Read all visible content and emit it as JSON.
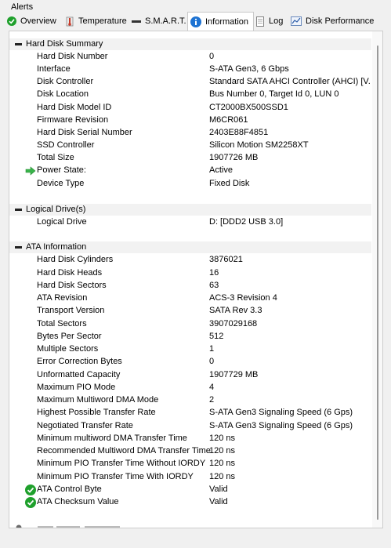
{
  "alerts": {
    "label": "Alerts"
  },
  "tabs": [
    {
      "label": "Overview",
      "icon": "check-circle-icon"
    },
    {
      "label": "Temperature",
      "icon": "thermometer-icon"
    },
    {
      "label": "S.M.A.R.T.",
      "icon": "smart-bar-icon"
    },
    {
      "label": "Information",
      "icon": "info-icon",
      "active": true
    },
    {
      "label": "Log",
      "icon": "log-page-icon"
    },
    {
      "label": "Disk Performance",
      "icon": "performance-chart-icon"
    }
  ],
  "groups": [
    {
      "title": "Hard Disk Summary",
      "rows": [
        {
          "label": "Hard Disk Number",
          "value": "0"
        },
        {
          "label": "Interface",
          "value": "S-ATA Gen3, 6 Gbps"
        },
        {
          "label": "Disk Controller",
          "value": "Standard SATA AHCI Controller (AHCI) [V..."
        },
        {
          "label": "Disk Location",
          "value": "Bus Number 0, Target Id 0, LUN 0"
        },
        {
          "label": "Hard Disk Model ID",
          "value": "CT2000BX500SSD1"
        },
        {
          "label": "Firmware Revision",
          "value": "M6CR061"
        },
        {
          "label": "Hard Disk Serial Number",
          "value": "2403E88F4851"
        },
        {
          "label": "SSD Controller",
          "value": "Silicon Motion SM2258XT"
        },
        {
          "label": "Total Size",
          "value": "1907726 MB"
        },
        {
          "label": "Power State:",
          "value": "Active",
          "icon": "green-arrow-icon"
        },
        {
          "label": "Device Type",
          "value": "Fixed Disk"
        }
      ]
    },
    {
      "title": "Logical Drive(s)",
      "rows": [
        {
          "label": "Logical Drive",
          "value": "D: [DDD2 USB 3.0]"
        }
      ]
    },
    {
      "title": "ATA Information",
      "rows": [
        {
          "label": "Hard Disk Cylinders",
          "value": "3876021"
        },
        {
          "label": "Hard Disk Heads",
          "value": "16"
        },
        {
          "label": "Hard Disk Sectors",
          "value": "63"
        },
        {
          "label": "ATA Revision",
          "value": "ACS-3 Revision 4"
        },
        {
          "label": "Transport Version",
          "value": "SATA Rev 3.3"
        },
        {
          "label": "Total Sectors",
          "value": "3907029168"
        },
        {
          "label": "Bytes Per Sector",
          "value": "512"
        },
        {
          "label": "Multiple Sectors",
          "value": "1"
        },
        {
          "label": "Error Correction Bytes",
          "value": "0"
        },
        {
          "label": "Unformatted Capacity",
          "value": "1907729 MB"
        },
        {
          "label": "Maximum PIO Mode",
          "value": "4"
        },
        {
          "label": "Maximum Multiword DMA Mode",
          "value": "2"
        },
        {
          "label": "Highest Possible Transfer Rate",
          "value": "S-ATA Gen3 Signaling Speed (6 Gps)"
        },
        {
          "label": "Negotiated Transfer Rate",
          "value": "S-ATA Gen3 Signaling Speed (6 Gps)"
        },
        {
          "label": "Minimum multiword DMA Transfer Time",
          "value": "120 ns"
        },
        {
          "label": "Recommended Multiword DMA Transfer Time",
          "value": "120 ns"
        },
        {
          "label": "Minimum PIO Transfer Time Without IORDY",
          "value": "120 ns"
        },
        {
          "label": "Minimum PIO Transfer Time With IORDY",
          "value": "120 ns"
        },
        {
          "label": "ATA Control Byte",
          "value": "Valid",
          "icon": "green-check-icon"
        },
        {
          "label": "ATA Checksum Value",
          "value": "Valid",
          "icon": "green-check-icon"
        }
      ]
    }
  ],
  "colors": {
    "panel_bg": "#ffffff",
    "window_bg": "#f0f0f0",
    "group_header_bg": "#f2f2f2",
    "ok_green": "#1fa02c",
    "info_blue": "#1e73d2"
  }
}
